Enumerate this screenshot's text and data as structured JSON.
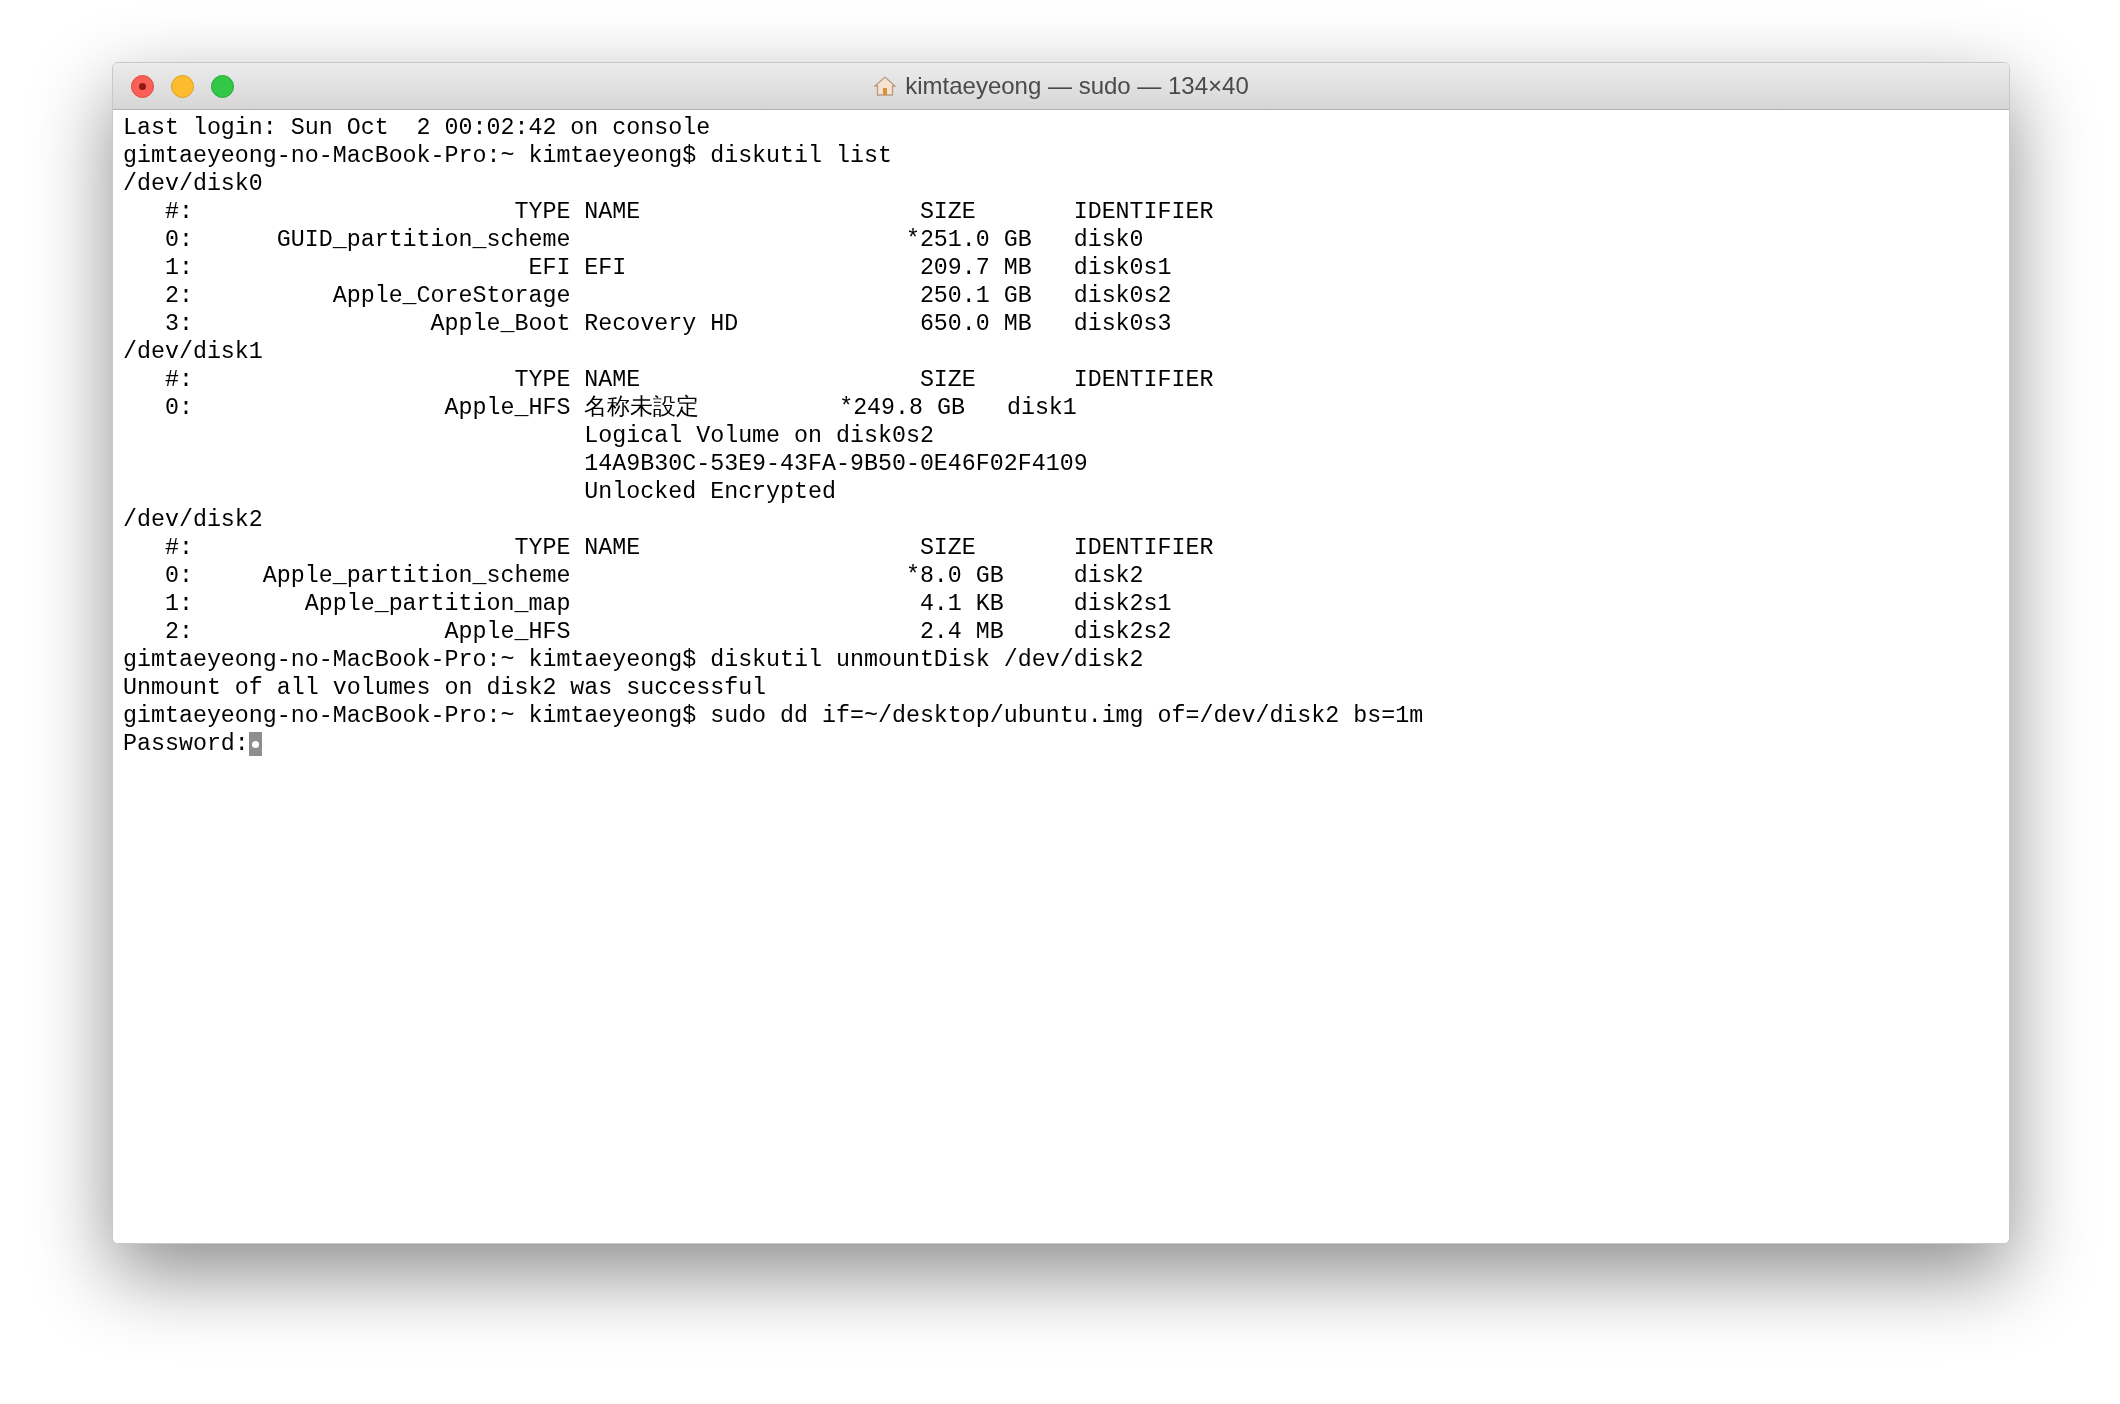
{
  "window": {
    "title": "kimtaeyeong — sudo — 134×40"
  },
  "terminal": {
    "lines": [
      "Last login: Sun Oct  2 00:02:42 on console",
      "gimtaeyeong-no-MacBook-Pro:~ kimtaeyeong$ diskutil list",
      "/dev/disk0",
      "   #:                       TYPE NAME                    SIZE       IDENTIFIER",
      "   0:      GUID_partition_scheme                        *251.0 GB   disk0",
      "   1:                        EFI EFI                     209.7 MB   disk0s1",
      "   2:          Apple_CoreStorage                         250.1 GB   disk0s2",
      "   3:                 Apple_Boot Recovery HD             650.0 MB   disk0s3",
      "/dev/disk1",
      "   #:                       TYPE NAME                    SIZE       IDENTIFIER",
      "   0:                  Apple_HFS 名称未設定          *249.8 GB   disk1",
      "                                 Logical Volume on disk0s2",
      "                                 14A9B30C-53E9-43FA-9B50-0E46F02F4109",
      "                                 Unlocked Encrypted",
      "/dev/disk2",
      "   #:                       TYPE NAME                    SIZE       IDENTIFIER",
      "   0:     Apple_partition_scheme                        *8.0 GB     disk2",
      "   1:        Apple_partition_map                         4.1 KB     disk2s1",
      "   2:                  Apple_HFS                         2.4 MB     disk2s2",
      "gimtaeyeong-no-MacBook-Pro:~ kimtaeyeong$ diskutil unmountDisk /dev/disk2",
      "Unmount of all volumes on disk2 was successful",
      "gimtaeyeong-no-MacBook-Pro:~ kimtaeyeong$ sudo dd if=~/desktop/ubuntu.img of=/dev/disk2 bs=1m"
    ],
    "input_line": {
      "text": "Password:",
      "cursor": true
    }
  }
}
